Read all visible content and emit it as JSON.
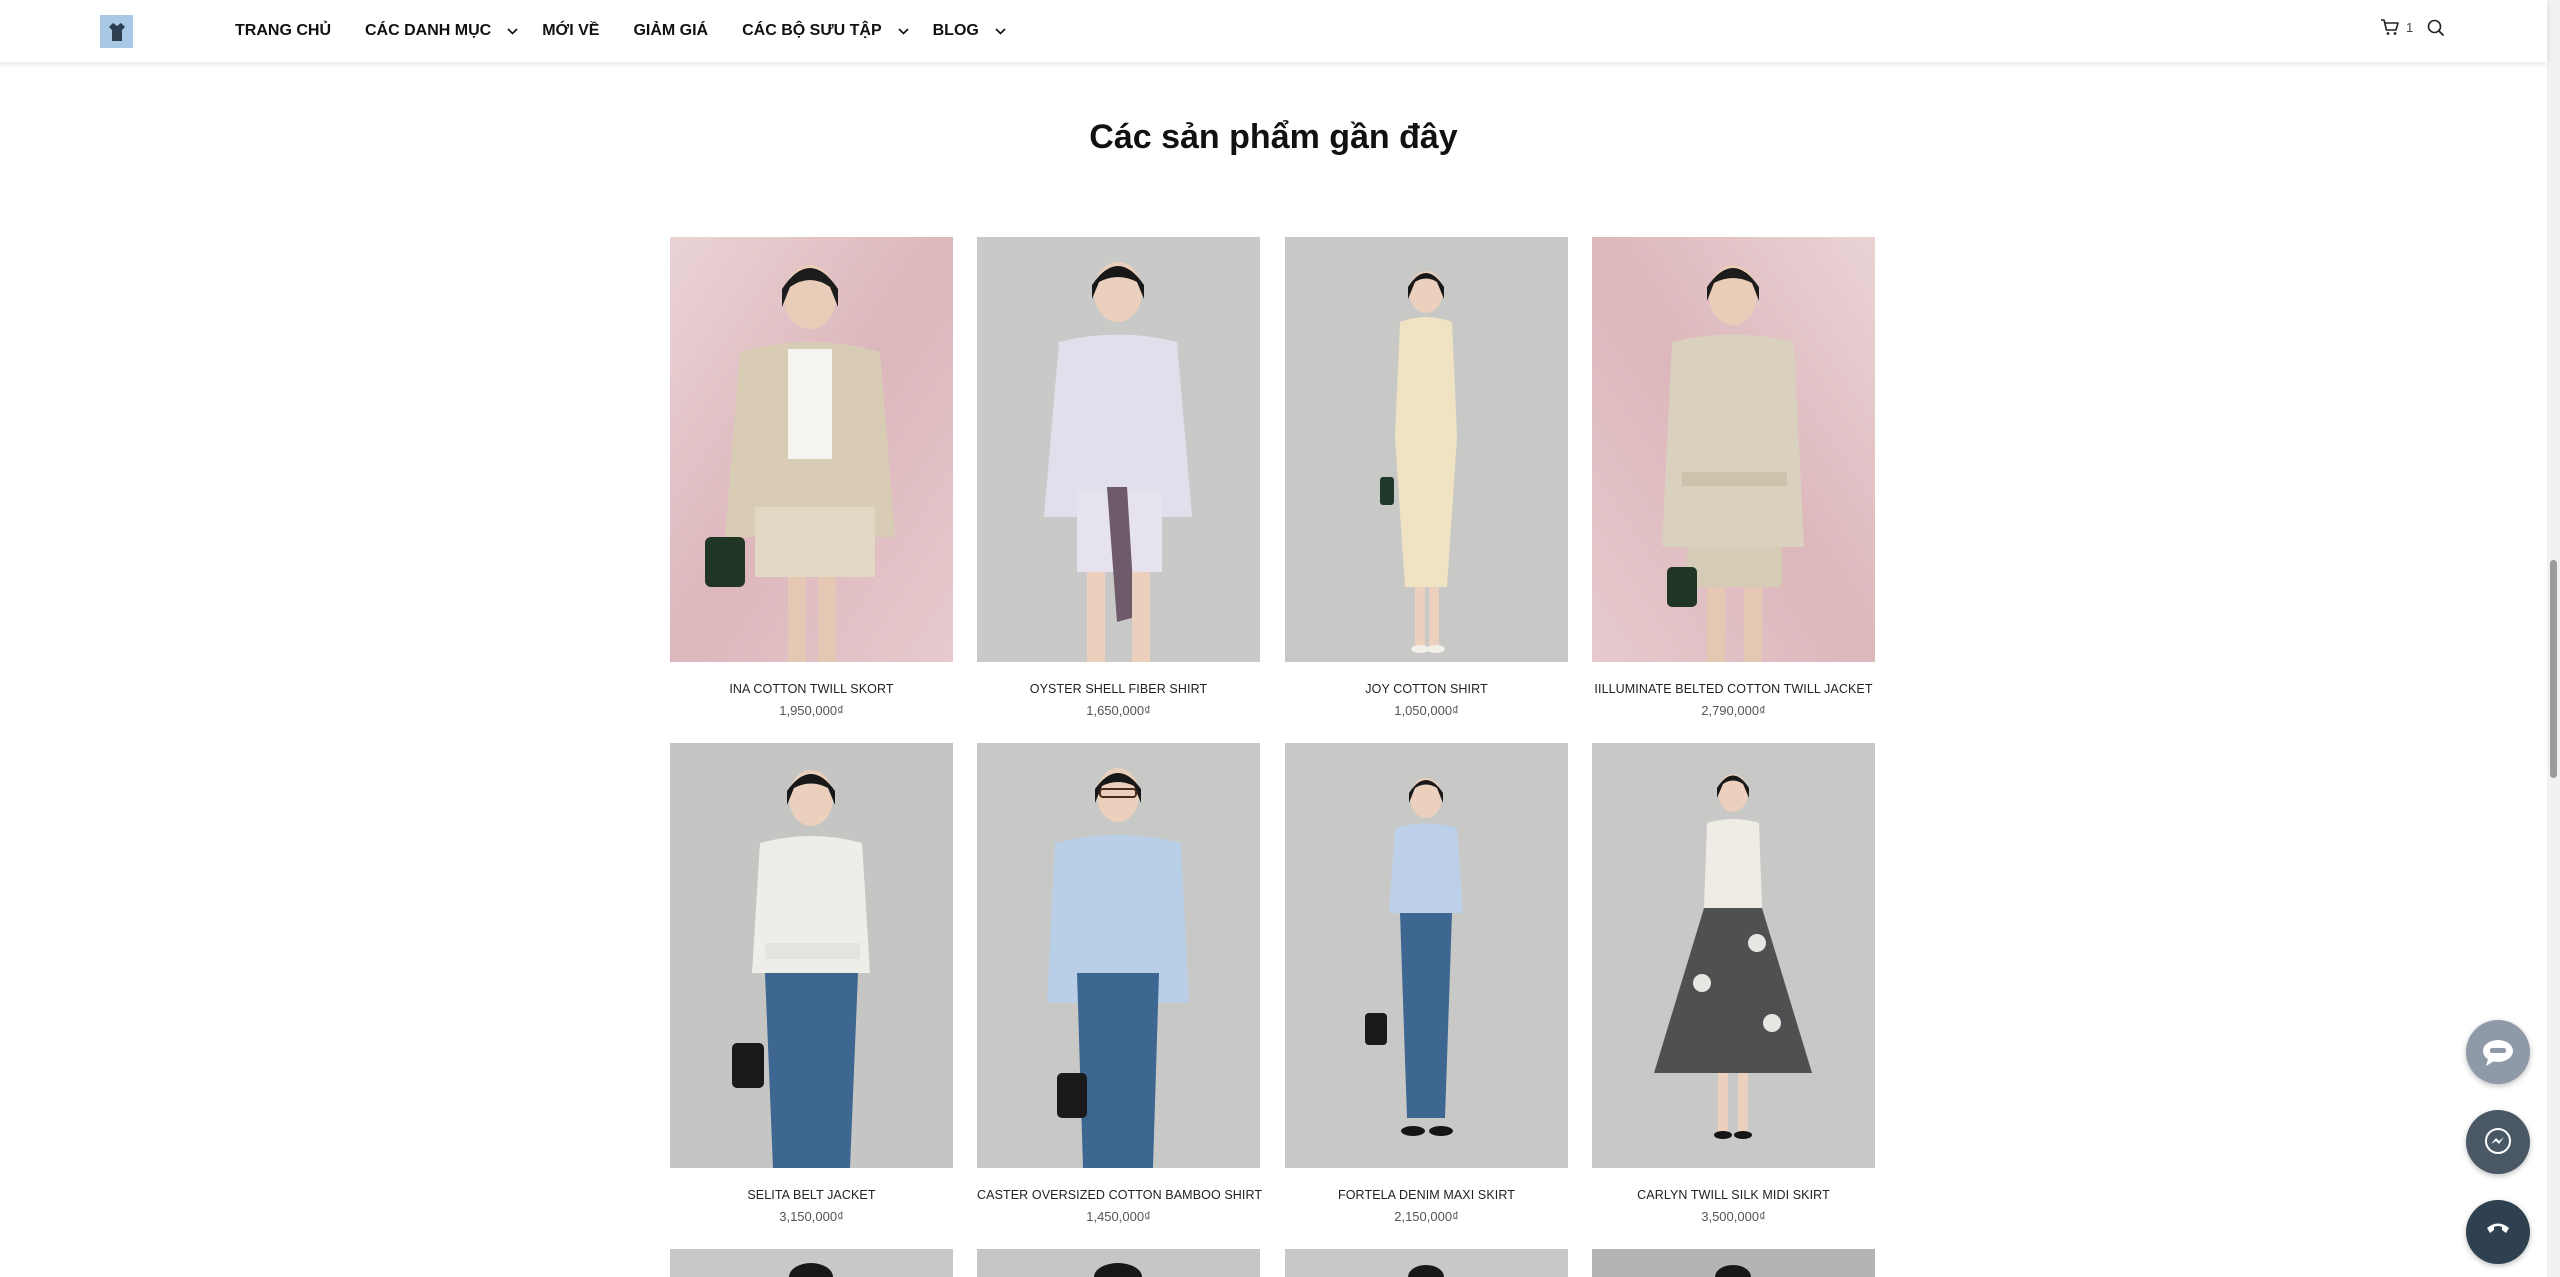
{
  "header": {
    "logo_icon": "shirt-logo-icon",
    "nav": [
      {
        "label": "TRANG CHỦ",
        "has_dropdown": false
      },
      {
        "label": "CÁC DANH MỤC",
        "has_dropdown": true
      },
      {
        "label": "MỚI VỀ",
        "has_dropdown": false
      },
      {
        "label": "GIẢM GIÁ",
        "has_dropdown": false
      },
      {
        "label": "CÁC BỘ SƯU TẬP",
        "has_dropdown": true
      },
      {
        "label": "BLOG",
        "has_dropdown": true
      }
    ],
    "cart_count": "1",
    "cart_icon": "cart-icon",
    "search_icon": "search-icon"
  },
  "section": {
    "title": "Các sản phẩm gần đây"
  },
  "products": [
    {
      "name": "INA COTTON TWILL SKORT",
      "price": "1,950,000₫",
      "bg": "pink",
      "outfit": "beige-jacket-skort"
    },
    {
      "name": "OYSTER SHELL FIBER SHIRT",
      "price": "1,650,000₫",
      "bg": "grey",
      "outfit": "lavender-shirt-tie"
    },
    {
      "name": "JOY COTTON SHIRT",
      "price": "1,050,000₫",
      "bg": "grey",
      "outfit": "cream-dress"
    },
    {
      "name": "IILLUMINATE BELTED COTTON TWILL JACKET",
      "price": "2,790,000₫",
      "bg": "pink",
      "outfit": "beige-belted-jacket"
    },
    {
      "name": "SELITA BELT JACKET",
      "price": "3,150,000₫",
      "bg": "grey",
      "outfit": "white-jacket-denim"
    },
    {
      "name": "CASTER OVERSIZED COTTON BAMBOO SHIRT",
      "price": "1,450,000₫",
      "bg": "grey",
      "outfit": "blue-shirt-denim"
    },
    {
      "name": "FORTELA DENIM MAXI SKIRT",
      "price": "2,150,000₫",
      "bg": "grey",
      "outfit": "blue-shirt-denim-2"
    },
    {
      "name": "CARLYN TWILL SILK MIDI SKIRT",
      "price": "3,500,000₫",
      "bg": "grey",
      "outfit": "white-top-grey-skirt"
    }
  ],
  "floating": {
    "zalo_icon": "zalo-chat-icon",
    "messenger_icon": "messenger-icon",
    "phone_icon": "phone-icon"
  },
  "colors": {
    "pink_bg": "#e3c4c8",
    "grey_bg": "#c7c8c6",
    "float_grey": "#8e9aa7",
    "float_dark": "#2f4050",
    "scroll_thumb": "#9a9a9a"
  }
}
